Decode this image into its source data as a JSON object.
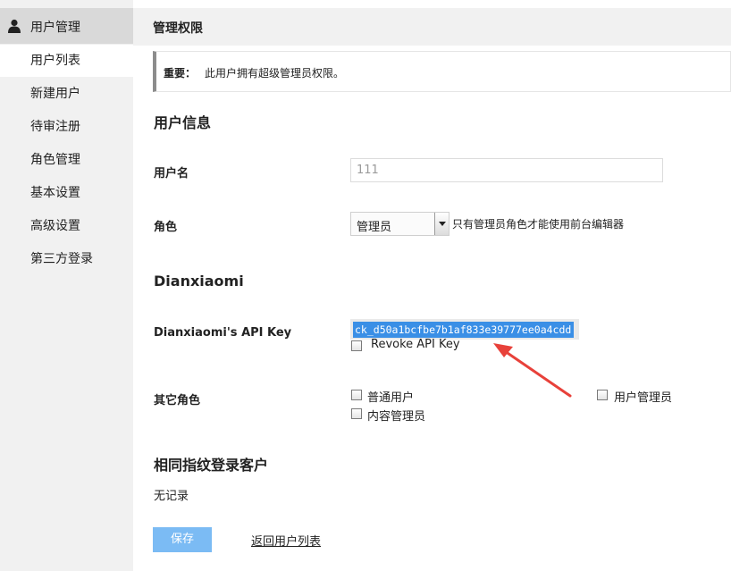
{
  "sidebar": {
    "header": {
      "label": "用户管理",
      "icon": "user-icon"
    },
    "items": [
      {
        "label": "用户列表",
        "active": true
      },
      {
        "label": "新建用户",
        "active": false
      },
      {
        "label": "待审注册",
        "active": false
      },
      {
        "label": "角色管理",
        "active": false
      },
      {
        "label": "基本设置",
        "active": false
      },
      {
        "label": "高级设置",
        "active": false
      },
      {
        "label": "第三方登录",
        "active": false
      }
    ]
  },
  "main": {
    "header_title": "管理权限",
    "notice": {
      "strong": "重要：",
      "message": "此用户拥有超级管理员权限。"
    },
    "user_info": {
      "section_title": "用户信息",
      "username_label": "用户名",
      "username_value": "111",
      "role_label": "角色",
      "role_value": "管理员",
      "role_hint": "只有管理员角色才能使用前台编辑器"
    },
    "dianxiaomi": {
      "section_title": "Dianxiaomi",
      "api_key_label": "Dianxiaomi's API Key",
      "api_key_value": "ck_d50a1bcfbe7b1af833e39777ee0a4cdd",
      "revoke_label": "Revoke API Key"
    },
    "other_roles": {
      "label": "其它角色",
      "options": [
        {
          "label": "普通用户",
          "checked": false
        },
        {
          "label": "用户管理员",
          "checked": false
        },
        {
          "label": "内容管理员",
          "checked": false
        }
      ]
    },
    "fingerprint": {
      "section_title": "相同指纹登录客户",
      "empty_text": "无记录"
    },
    "actions": {
      "save_label": "保存",
      "back_label": "返回用户列表"
    }
  },
  "colors": {
    "sidebar_bg": "#f1f1f1",
    "sidebar_header_bg": "#d9d9d9",
    "selection": "#3a8fe6",
    "save_button": "#7bbbf4",
    "annotation_arrow": "#e8413a"
  }
}
